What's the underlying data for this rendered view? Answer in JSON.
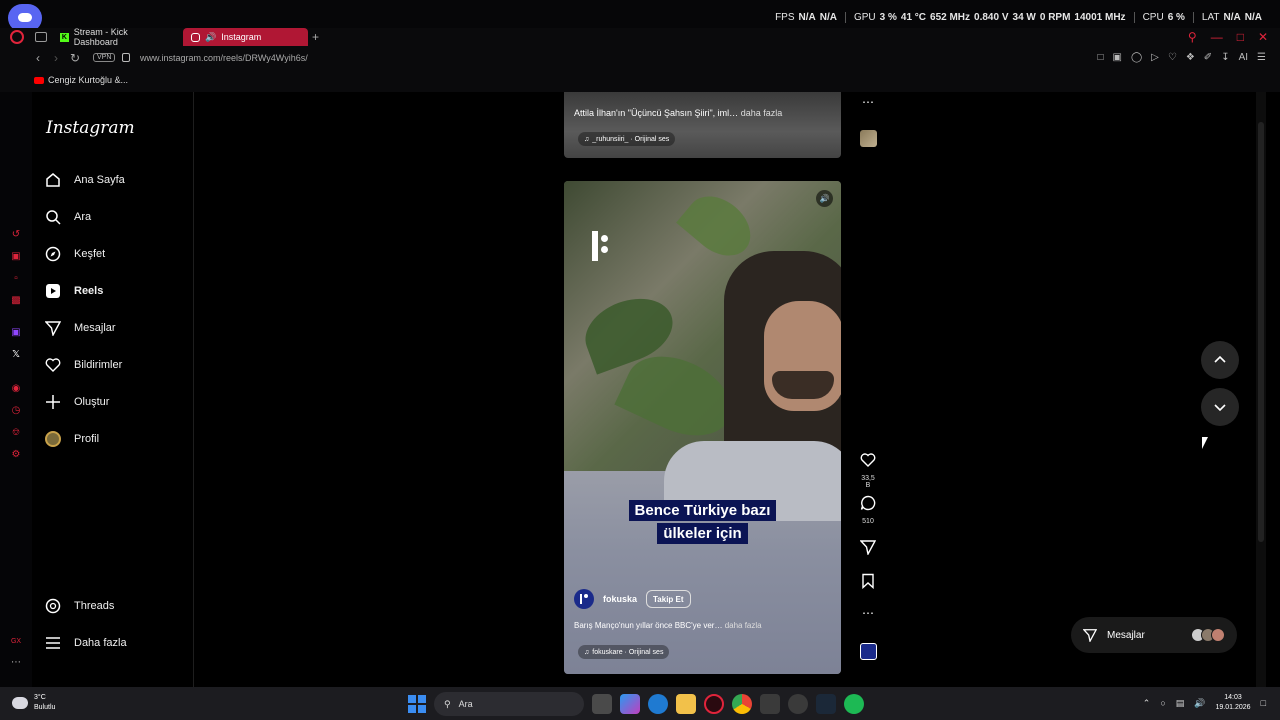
{
  "overlay": {
    "fps_label": "FPS",
    "fps_value1": "N/A",
    "fps_value2": "N/A",
    "gpu_label": "GPU",
    "gpu_load": "3 %",
    "gpu_temp": "41 °C",
    "gpu_clock": "652 MHz",
    "gpu_volt": "0.840 V",
    "gpu_power": "34 W",
    "gpu_rpm": "0 RPM",
    "gpu_mem": "14001 MHz",
    "cpu_label": "CPU",
    "cpu_load": "6 %",
    "lat_label": "LAT",
    "lat_value1": "N/A",
    "lat_value2": "N/A"
  },
  "browser": {
    "tabs": [
      {
        "label": "Stream - Kick Dashboard",
        "active": false
      },
      {
        "label": "Instagram",
        "active": true
      }
    ],
    "new_tab": "+",
    "vpn_label": "VPN",
    "url": "www.instagram.com/reels/DRWy4Wyih6s/",
    "ai_label": "AI",
    "bookmark": "Cengiz Kurtoğlu &..."
  },
  "instagram": {
    "logo": "Instagram",
    "nav": [
      {
        "label": "Ana Sayfa",
        "icon": "home-icon"
      },
      {
        "label": "Ara",
        "icon": "search-icon"
      },
      {
        "label": "Keşfet",
        "icon": "compass-icon"
      },
      {
        "label": "Reels",
        "icon": "reels-icon",
        "active": true
      },
      {
        "label": "Mesajlar",
        "icon": "send-icon"
      },
      {
        "label": "Bildirimler",
        "icon": "heart-icon"
      },
      {
        "label": "Oluştur",
        "icon": "plus-icon"
      },
      {
        "label": "Profil",
        "icon": "avatar"
      }
    ],
    "bottom_nav": [
      {
        "label": "Threads",
        "icon": "threads-icon"
      },
      {
        "label": "Daha fazla",
        "icon": "menu-icon"
      }
    ],
    "prev_reel": {
      "caption": "Attila İlhan'ın \"Üçüncü Şahsın Şiiri\", iml…",
      "more": "daha fazla",
      "audio": "_ruhunsiiri_ · Orijinal ses"
    },
    "reel": {
      "subtitle_line1": "Bence Türkiye bazı",
      "subtitle_line2": "ülkeler için",
      "username": "fokuska",
      "follow": "Takip Et",
      "caption": "Barış Manço'nun yıllar önce BBC'ye ver…",
      "more": "daha fazla",
      "audio": "fokuskare · Orijinal ses",
      "likes": "33,5 B",
      "comments": "510"
    },
    "messages_pill": "Mesajlar"
  },
  "taskbar": {
    "temp": "3°C",
    "weather": "Bulutlu",
    "search": "Ara",
    "time": "14:03",
    "date": "19.01.2026"
  },
  "colors": {
    "opera_red": "#e0243b",
    "active_tab": "#b01734",
    "subtitle_bg": "#0b1454"
  }
}
